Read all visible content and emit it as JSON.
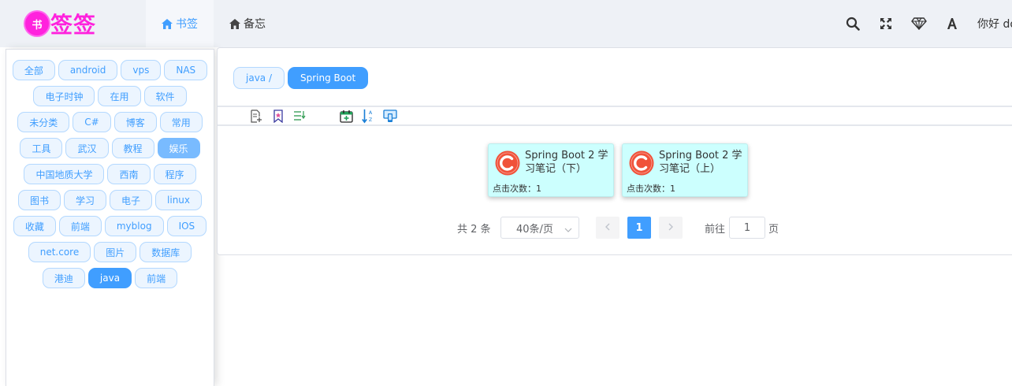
{
  "logo": {
    "badge": "书",
    "text": "签签"
  },
  "nav": {
    "bookmarks": "书签",
    "memo": "备忘"
  },
  "header": {
    "greeting": "你好 do"
  },
  "tag_rows": [
    [
      "全部",
      "android",
      "vps",
      "NAS"
    ],
    [
      "电子时钟",
      "在用",
      "软件"
    ],
    [
      "未分类",
      "C#",
      "博客",
      "常用"
    ],
    [
      "工具",
      "武汉",
      "教程",
      "娱乐"
    ],
    [
      "中国地质大学",
      "西南",
      "程序"
    ],
    [
      "图书",
      "学习",
      "电子",
      "linux"
    ],
    [
      "收藏",
      "前端",
      "myblog",
      "IOS"
    ],
    [
      "net.core",
      "图片",
      "数据库"
    ],
    [
      "港迪",
      "java",
      "前端"
    ]
  ],
  "hovered_tag": "娱乐",
  "active_tag": "java",
  "breadcrumb": {
    "parent": "java /",
    "current": "Spring Boot"
  },
  "cards": [
    {
      "title": "Spring Boot 2 学习笔记（下）",
      "clicks": "点击次数：1"
    },
    {
      "title": "Spring Boot 2 学习笔记（上）",
      "clicks": "点击次数：1"
    }
  ],
  "pagination": {
    "total": "共 2 条",
    "page_size": "40条/页",
    "current_page": "1",
    "goto_label": "前往",
    "goto_value": "1",
    "page_label": "页"
  },
  "colors": {
    "accent": "#409eff",
    "logo": "#ff22dd",
    "card_bg": "#ccfffe",
    "card_icon": "#f0523a"
  }
}
